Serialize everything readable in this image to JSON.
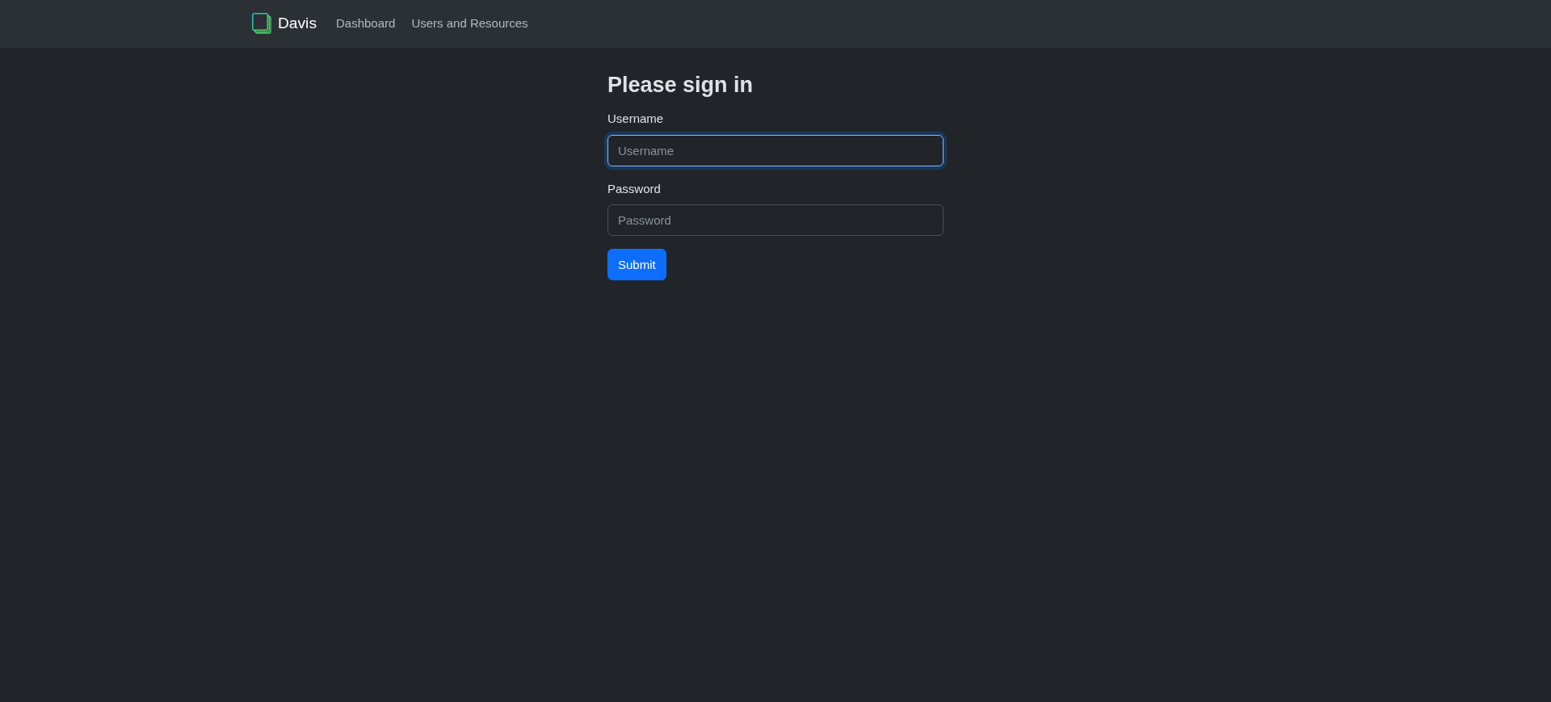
{
  "navbar": {
    "brand": "Davis",
    "links": [
      {
        "label": "Dashboard",
        "selected": false
      },
      {
        "label": "Users and Resources",
        "selected": false
      }
    ]
  },
  "form": {
    "title": "Please sign in",
    "fields": [
      {
        "label": "Username",
        "placeholder": "Username",
        "focused": true
      },
      {
        "label": "Password",
        "placeholder": "Password",
        "focused": false
      }
    ],
    "submit": "Submit"
  }
}
